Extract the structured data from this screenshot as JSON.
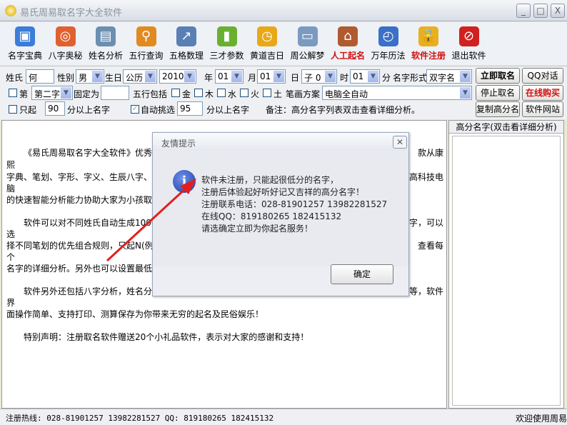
{
  "window": {
    "title": "易氏周易取名字大全软件",
    "min": "_",
    "max": "□",
    "close": "X"
  },
  "toolbar": [
    {
      "label": "名字宝典",
      "icon": "gift-icon",
      "color": "#3b7dd8",
      "glyph": "▣",
      "red": false
    },
    {
      "label": "八字奥秘",
      "icon": "lifebuoy-icon",
      "color": "#e06030",
      "glyph": "◎",
      "red": false
    },
    {
      "label": "姓名分析",
      "icon": "clipboard-icon",
      "color": "#6b8fb0",
      "glyph": "▤",
      "red": false
    },
    {
      "label": "五行查询",
      "icon": "magnifier-icon",
      "color": "#e08a20",
      "glyph": "⚲",
      "red": false
    },
    {
      "label": "五格数理",
      "icon": "chart-icon",
      "color": "#5a7fb5",
      "glyph": "↗",
      "red": false
    },
    {
      "label": "三才参数",
      "icon": "bar-chart-icon",
      "color": "#6ab030",
      "glyph": "▮",
      "red": false
    },
    {
      "label": "黄道吉日",
      "icon": "calendar-clock-icon",
      "color": "#e8a818",
      "glyph": "◷",
      "red": false
    },
    {
      "label": "周公解梦",
      "icon": "monitor-icon",
      "color": "#7a9ac0",
      "glyph": "▭",
      "red": false
    },
    {
      "label": "人工起名",
      "icon": "house-icon",
      "color": "#b05a30",
      "glyph": "⌂",
      "red": true
    },
    {
      "label": "万年历法",
      "icon": "alarm-clock-icon",
      "color": "#3a70c8",
      "glyph": "◴",
      "red": false
    },
    {
      "label": "软件注册",
      "icon": "lock-icon",
      "color": "#e8b020",
      "glyph": "🔒",
      "red": true
    },
    {
      "label": "退出软件",
      "icon": "stop-icon",
      "color": "#d02020",
      "glyph": "⊘",
      "red": false
    }
  ],
  "form": {
    "surname_label": "姓氏",
    "surname": "何",
    "gender_label": "性别",
    "gender": "男",
    "birth_label": "生日",
    "calendar": "公历",
    "year": "2010",
    "year_label": "年",
    "month": "01",
    "month_label": "月",
    "day": "01",
    "day_label": "日",
    "hour_branch": "子 0",
    "hour_label": "时",
    "minute": "01",
    "minute_label": "分",
    "name_form_label": "名字形式",
    "name_form": "双字名",
    "fix_label": "第",
    "fix_position": "第二字",
    "fixed_as_label": "固定为",
    "fixed_as": "",
    "wuxing_label": "五行包括",
    "wuxing": [
      "金",
      "木",
      "水",
      "火",
      "土"
    ],
    "stroke_label": "笔画方案",
    "stroke_plan": "电脑全自动",
    "only_label": "只起",
    "only_score": "90",
    "only_suffix": "分以上名字",
    "auto_label": "自动挑选",
    "auto_score": "95",
    "auto_suffix": "分以上名字",
    "note": "备注：高分名字列表双击查看详细分析。",
    "buttons": {
      "generate": "立即取名",
      "qq": "QQ对话",
      "stop": "停止取名",
      "buy": "在线购买",
      "copy": "复制高分名",
      "website": "软件网站"
    }
  },
  "main_text": [
    {
      "left": "《易氏周易取名字大全软件》优秀的",
      "right": "款从康",
      "indent": true
    },
    {
      "left": "熙",
      "right": ""
    },
    {
      "left": "字典、笔划、字形、字义、生辰八字、",
      "right": "高科技电"
    },
    {
      "left": "脑",
      "right": ""
    },
    {
      "left": "的快速智能分析能力协助大家为小孩取",
      "right": ""
    },
    {
      "left": "软件可以对不同姓氏自动生成1000",
      "right": "字，可以",
      "indent": true
    },
    {
      "left": "选",
      "right": ""
    },
    {
      "left": "择不同笔划的优先组合规则，只起N(例",
      "right": "查看每"
    },
    {
      "left": "个",
      "right": ""
    },
    {
      "left": "名字的详细分析。另外也可以设置最低",
      "right": ""
    },
    {
      "left": "软件另外还包括八字分析，姓名分",
      "right": "等，软件",
      "indent": true
    },
    {
      "left": "界",
      "right": ""
    },
    {
      "left": "面操作简单、支持打印、测算保存为你带来无穷的起名及民俗娱乐！",
      "right": ""
    },
    {
      "left": "特别声明：注册取名软件赠送20个小礼品软件，表示对大家的感谢和支持！",
      "right": "",
      "indent": true
    }
  ],
  "right_panel": {
    "header": "高分名字(双击看详细分析)"
  },
  "status": {
    "hotline": "注册热线: 028-81901257 13982281527 QQ: 819180265 182415132",
    "welcome": "欢迎使用周易"
  },
  "dialog": {
    "title": "友情提示",
    "close": "✕",
    "icon_glyph": "i",
    "lines": [
      "软件未注册，只能起很低分的名字，",
      "注册后体验起好听好记又吉祥的高分名字！",
      "注册联系电话：028-81901257 13982281527",
      "在线QQ：819180265 182415132",
      "请选确定立即为你起名服务！"
    ],
    "ok": "确定"
  },
  "colors": {
    "arrow": "#e02020",
    "red_label": "#d01010"
  }
}
